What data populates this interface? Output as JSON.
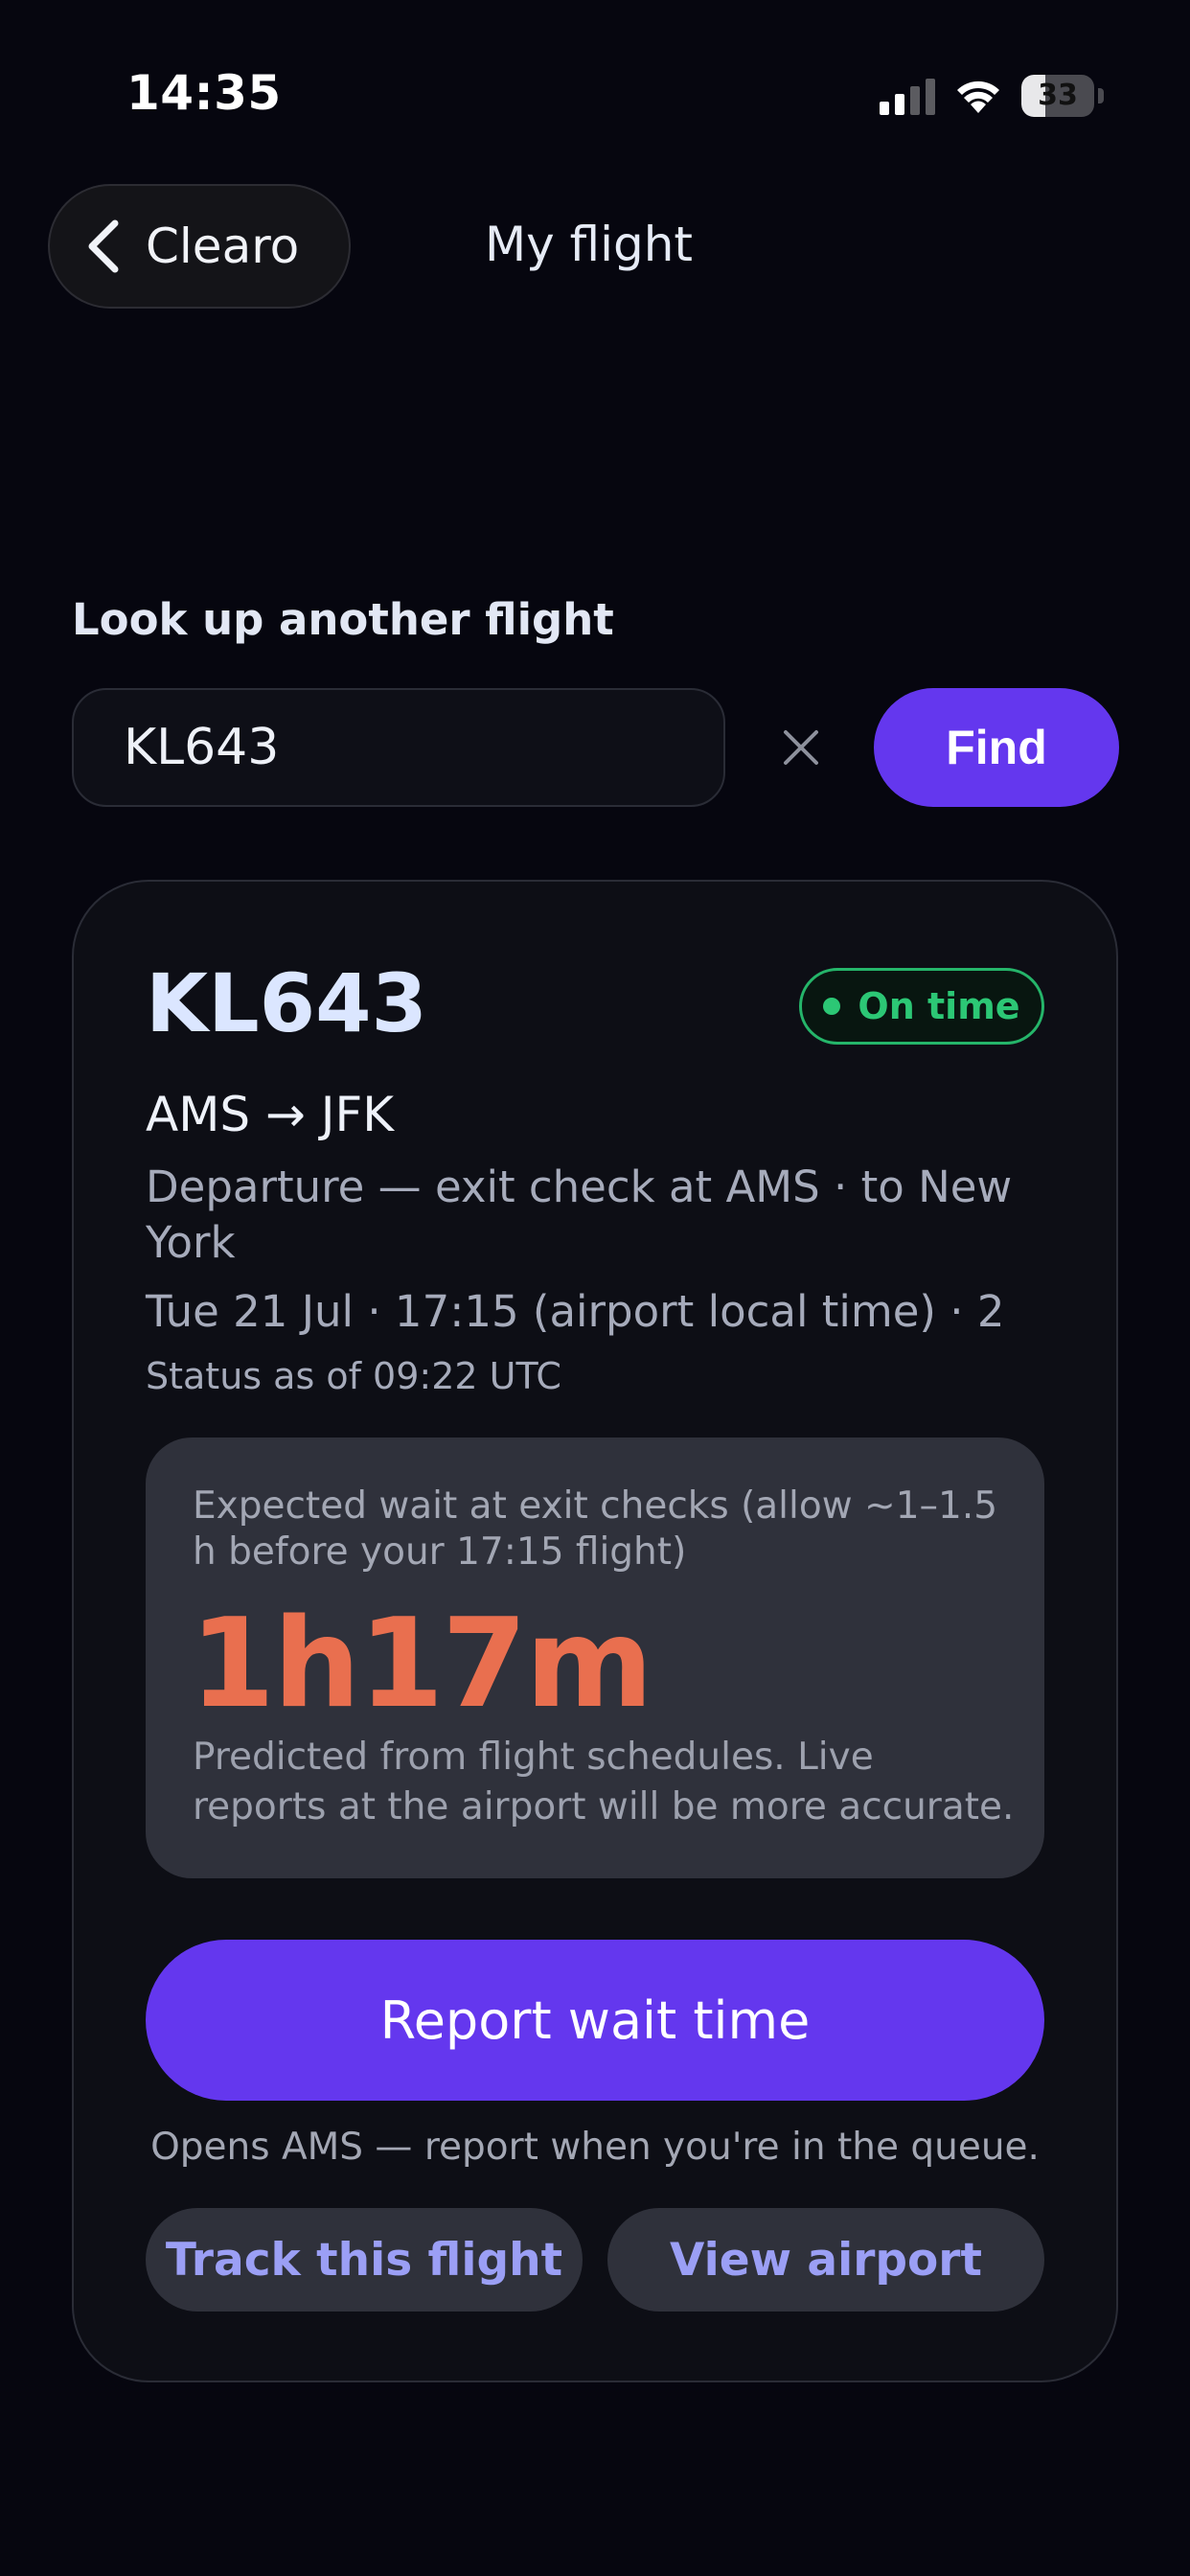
{
  "status_bar": {
    "time": "14:35",
    "battery_percent": "33",
    "battery_level": 0.33
  },
  "nav": {
    "back_label": "Clearo",
    "title": "My flight"
  },
  "lookup": {
    "label": "Look up another flight",
    "input_value": "KL643",
    "find_label": "Find"
  },
  "flight": {
    "code": "KL643",
    "status": "On time",
    "route": "AMS → JFK",
    "description": "Departure — exit check at AMS · to New York",
    "datetime": "Tue 21 Jul · 17:15 (airport local time) · 2",
    "status_as_of": "Status as of 09:22 UTC"
  },
  "wait": {
    "label": "Expected wait at exit checks (allow ~1–1.5 h before your 17:15 flight)",
    "value": "1h17m",
    "note": "Predicted from flight schedules. Live reports at the airport will be more accurate."
  },
  "actions": {
    "report_label": "Report wait time",
    "report_hint": "Opens AMS — report when you're in the queue.",
    "track_label": "Track this flight",
    "airport_label": "View airport"
  },
  "colors": {
    "background": "#06060f",
    "accent": "#6437ee",
    "status_green": "#2cc775",
    "wait_orange": "#e96f4f",
    "link_lavender": "#9b9ff5"
  },
  "icons": [
    "signal-icon",
    "wifi-icon",
    "battery-icon",
    "chevron-left-icon",
    "close-icon",
    "status-dot-icon"
  ]
}
